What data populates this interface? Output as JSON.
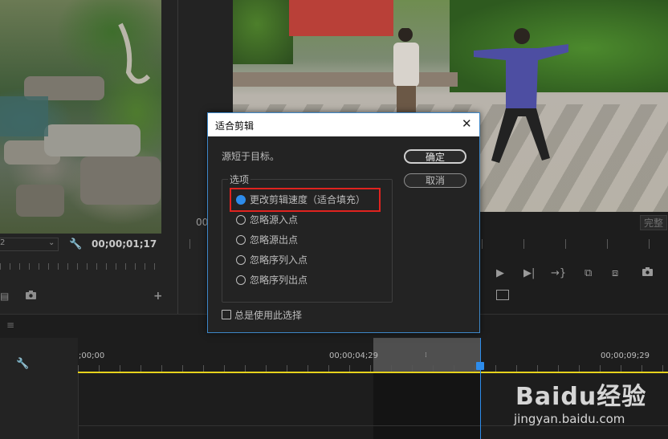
{
  "source_monitor": {
    "timecode": "00;00;01;17",
    "dropdown_text": "2"
  },
  "program_monitor": {
    "timecode_fragment": "00",
    "complete_label": "完整"
  },
  "timeline": {
    "timecodes": [
      ";00;00",
      "00;00;04;29",
      "00;00;09;29"
    ]
  },
  "dialog": {
    "title": "适合剪辑",
    "close_glyph": "✕",
    "message": "源短于目标。",
    "ok_label": "确定",
    "cancel_label": "取消",
    "options_legend": "选项",
    "options": [
      {
        "label": "更改剪辑速度（适合填充）",
        "selected": true
      },
      {
        "label": "忽略源入点",
        "selected": false
      },
      {
        "label": "忽略源出点",
        "selected": false
      },
      {
        "label": "忽略序列入点",
        "selected": false
      },
      {
        "label": "忽略序列出点",
        "selected": false
      }
    ],
    "always_use_label": "总是使用此选择",
    "always_use_checked": false
  },
  "icons": {
    "wrench": "wrench-icon",
    "camera": "camera-icon",
    "plus": "plus-icon",
    "export": "export-frame-icon",
    "menu": "hamburger-icon"
  },
  "colors": {
    "accent": "#2d8ceb",
    "highlight_box": "#e0231f",
    "work_area": "#e6d21c"
  },
  "watermark": {
    "brand": "Baidu经验",
    "url": "jingyan.baidu.com"
  }
}
